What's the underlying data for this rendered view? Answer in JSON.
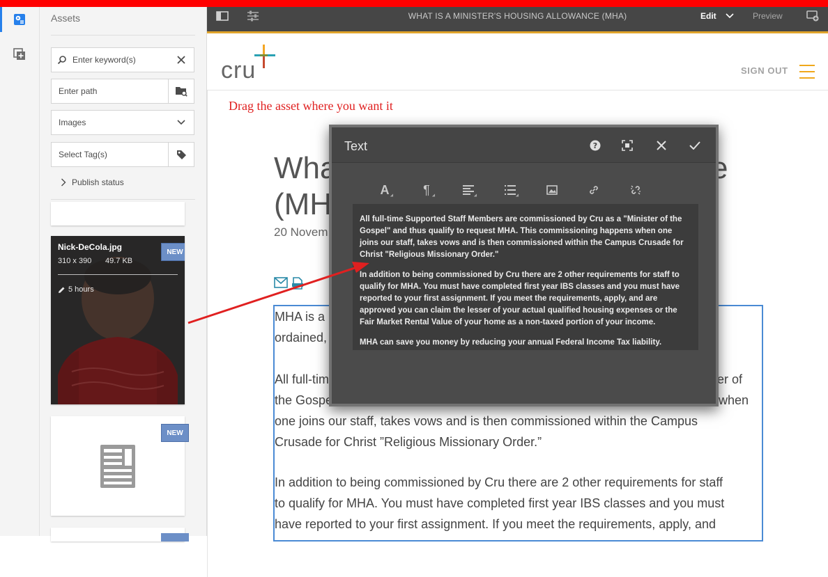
{
  "rail": {
    "items": [
      "assets",
      "components"
    ]
  },
  "panel": {
    "title": "Assets",
    "search": {
      "placeholder": "Enter keyword(s)"
    },
    "path": {
      "placeholder": "Enter path"
    },
    "type_select": {
      "value": "Images"
    },
    "tags": {
      "placeholder": "Select Tag(s)"
    },
    "publish_status": "Publish status",
    "assets": [
      {
        "filename": "Nick-DeCola.jpg",
        "dimensions": "310 x 390",
        "size": "49.7 KB",
        "modified": "5 hours",
        "badge": "NEW"
      },
      {
        "badge": "NEW"
      }
    ]
  },
  "toolbar": {
    "title": "WHAT IS A MINISTER'S HOUSING ALLOWANCE (MHA)",
    "edit_label": "Edit",
    "preview_label": "Preview"
  },
  "page": {
    "logo_text": "cru",
    "signout": "SIGN OUT",
    "hint": "Drag the asset where you want it",
    "title_line1": "What",
    "title_line1_end": "e",
    "title_line2": "(MHA",
    "date": "20 Novem",
    "body": [
      "MHA is a b",
      "ordained,",
      "All full-tim",
      "ister of",
      "the Gospe",
      "when",
      "one joins our staff, takes vows and is then commissioned within the Campus",
      "Crusade for Christ ”Religious Missionary Order.”",
      "In addition to being commissioned by Cru there are 2 other requirements for staff",
      "to qualify for MHA. You must have completed first year IBS classes and you must",
      "have reported to your first assignment. If you meet the requirements, apply, and"
    ]
  },
  "dialog": {
    "title": "Text",
    "tools": [
      "format-icon",
      "paragraph-icon",
      "align-icon",
      "list-icon",
      "image-icon",
      "link-icon",
      "unlink-icon"
    ],
    "paragraphs": [
      "All full-time Supported Staff Members are commissioned by Cru as a \"Minister of the Gospel\" and thus qualify to request MHA. This commissioning happens when one joins our staff, takes vows and is then commissioned within the Campus Crusade for Christ \"Religious Missionary Order.\"",
      "In addition to being commissioned by Cru there are 2 other requirements for staff to qualify for MHA. You must have completed first year IBS classes and you must have reported to your first assignment. If you meet the requirements, apply, and are approved you can claim the lesser of your actual qualified housing expenses or the Fair Market Rental Value of your home as a non-taxed portion of your income.",
      "MHA can save you money by reducing your annual Federal Income Tax liability. However,"
    ]
  },
  "colors": {
    "accent": "#2680eb",
    "toolbar_underline": "#e0a42b",
    "annotation": "#e02020",
    "badge": "#6c8fc7"
  }
}
